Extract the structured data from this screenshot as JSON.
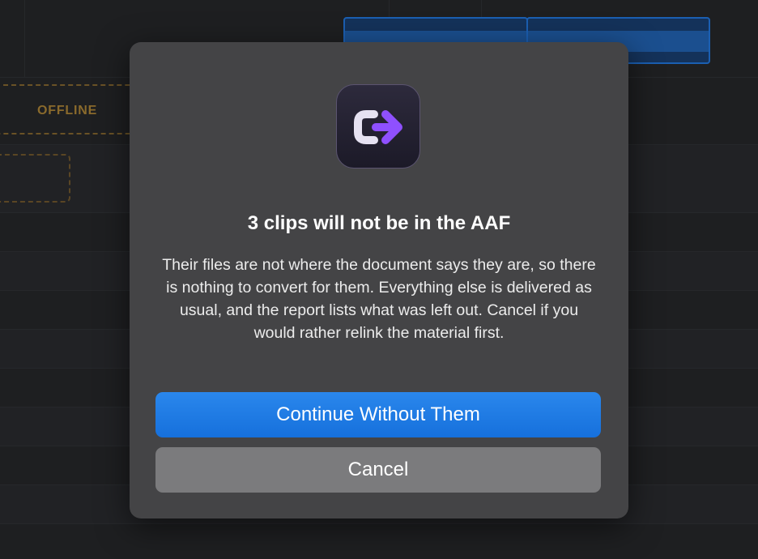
{
  "background": {
    "offline_label": "OFFLINE"
  },
  "dialog": {
    "icon": "convert-arrow-icon",
    "title": "3 clips will not be in the AAF",
    "message": "Their files are not where the document says they are, so there is nothing to convert for them. Everything else is delivered as usual, and the report lists what was left out. Cancel if you would rather relink the material first.",
    "primary_button": "Continue Without Them",
    "secondary_button": "Cancel"
  },
  "colors": {
    "accent": "#1a73e3",
    "offline": "#8a6a2c",
    "dialog_bg": "#444446",
    "icon_purple": "#8f50ff"
  }
}
